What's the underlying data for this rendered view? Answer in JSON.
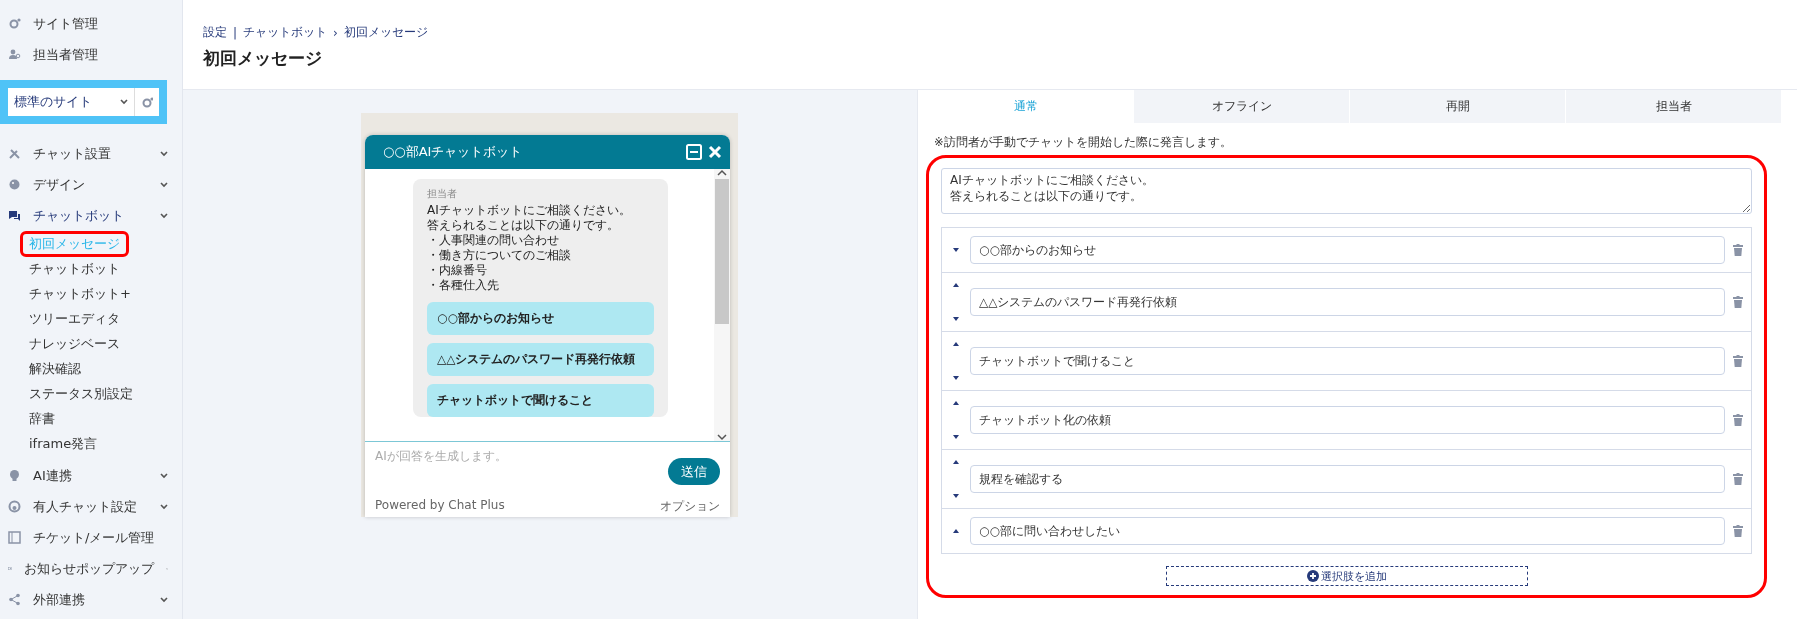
{
  "sidebar": {
    "top_items": [
      {
        "label": "サイト管理"
      },
      {
        "label": "担当者管理"
      }
    ],
    "site_select": {
      "value": "標準のサイト"
    },
    "menu": [
      {
        "label": "チャット設置",
        "expanded": false
      },
      {
        "label": "デザイン",
        "expanded": false
      },
      {
        "label": "チャットボット",
        "expanded": true,
        "children": [
          {
            "label": "初回メッセージ",
            "selected": true,
            "annotated": true
          },
          {
            "label": "チャットボット",
            "selected": false,
            "annotated": false
          },
          {
            "label": "チャットボット+",
            "selected": false,
            "annotated": false
          },
          {
            "label": "ツリーエディタ",
            "selected": false,
            "annotated": false
          },
          {
            "label": "ナレッジベース",
            "selected": false,
            "annotated": false
          },
          {
            "label": "解決確認",
            "selected": false,
            "annotated": false
          },
          {
            "label": "ステータス別設定",
            "selected": false,
            "annotated": false
          },
          {
            "label": "辞書",
            "selected": false,
            "annotated": false
          },
          {
            "label": "iframe発言",
            "selected": false,
            "annotated": false
          }
        ]
      },
      {
        "label": "AI連携",
        "expanded": false
      },
      {
        "label": "有人チャット設定",
        "expanded": false
      },
      {
        "label": "チケット/メール管理"
      },
      {
        "label": "お知らせポップアップ",
        "expanded": false
      },
      {
        "label": "外部連携",
        "expanded": false
      }
    ]
  },
  "header": {
    "breadcrumb": {
      "items": [
        "設定",
        "チャットボット",
        "初回メッセージ"
      ],
      "separators": [
        "|",
        "›"
      ]
    },
    "title": "初回メッセージ"
  },
  "preview": {
    "title": "○○部AIチャットボット",
    "sender": "担当者",
    "message_lines": [
      "AIチャットボットにご相談ください。",
      "答えられることは以下の通りです。",
      "・人事関連の問い合わせ",
      "・働き方についてのご相談",
      "・内線番号",
      "・各種仕入先"
    ],
    "choices": [
      "○○部からのお知らせ",
      "△△システムのパスワード再発行依頼",
      "チャットボットで聞けること"
    ],
    "input_placeholder": "AIが回答を生成します。",
    "send_button": "送信",
    "footer_left": "Powered by Chat Plus",
    "footer_right": "オプション"
  },
  "editor": {
    "tabs": [
      {
        "label": "通常",
        "selected": true
      },
      {
        "label": "オフライン",
        "selected": false
      },
      {
        "label": "再開",
        "selected": false
      },
      {
        "label": "担当者",
        "selected": false
      }
    ],
    "hint": "※訪問者が手動でチャットを開始した際に発言します。",
    "annotated": true,
    "message_lines": [
      "AIチャットボットにご相談ください。",
      "答えられることは以下の通りです。"
    ],
    "choices": [
      {
        "value": "○○部からのお知らせ",
        "can_move_up": false,
        "can_move_down": true
      },
      {
        "value": "△△システムのパスワード再発行依頼",
        "can_move_up": true,
        "can_move_down": true
      },
      {
        "value": "チャットボットで聞けること",
        "can_move_up": true,
        "can_move_down": true
      },
      {
        "value": "チャットボット化の依頼",
        "can_move_up": true,
        "can_move_down": true
      },
      {
        "value": "規程を確認する",
        "can_move_up": true,
        "can_move_down": true
      },
      {
        "value": "○○部に問い合わせしたい",
        "can_move_up": true,
        "can_move_down": false
      }
    ],
    "add_button": "選択肢を追加"
  }
}
